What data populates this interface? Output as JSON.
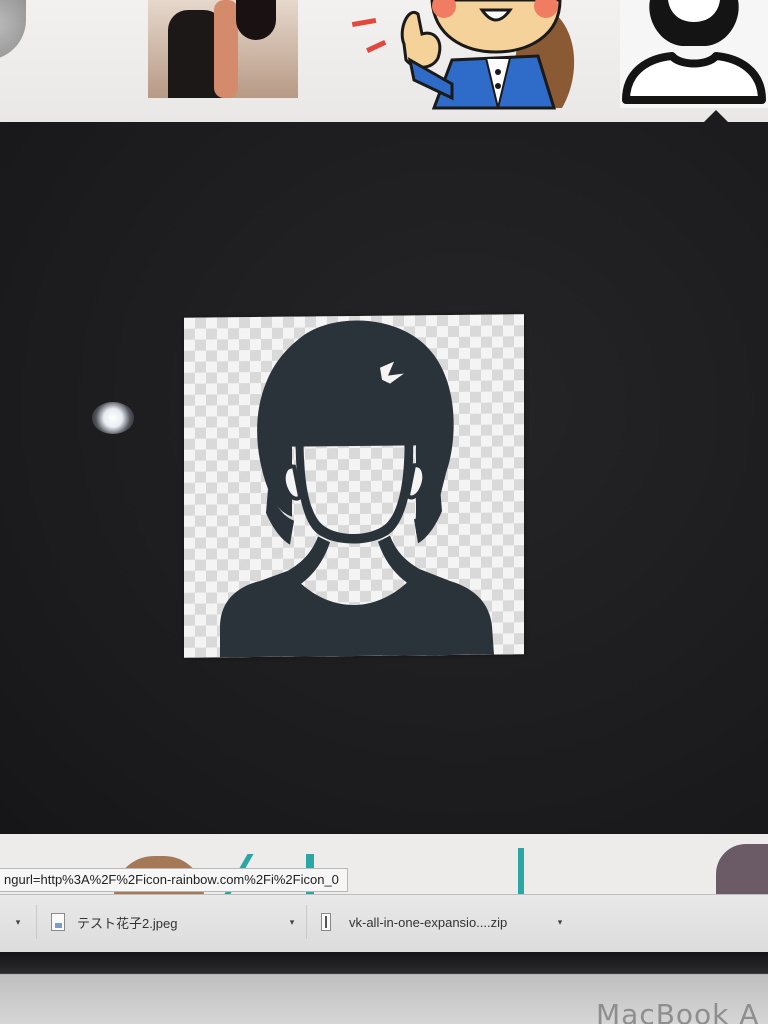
{
  "status_bar": {
    "url": "ngurl=http%3A%2F%2Ficon-rainbow.com%2Fi%2Ficon_0"
  },
  "downloads": [
    {
      "name": "",
      "icon": "chevron-down-icon",
      "chevron": "▾"
    },
    {
      "name": "テスト花子2.jpeg",
      "icon": "image-file-icon",
      "chevron": "▾"
    },
    {
      "name": "vk-all-in-one-expansio....zip",
      "icon": "zip-file-icon",
      "chevron": "▾"
    }
  ],
  "bezel": {
    "brand": "MacBook A"
  },
  "colors": {
    "silhouette": "#2a3237",
    "panel_bg": "#1c1c1e",
    "accent_teal": "#2aa7a5",
    "cartoon_blue": "#2f6cc9"
  },
  "preview": {
    "subject": "female-avatar-silhouette-icon"
  }
}
